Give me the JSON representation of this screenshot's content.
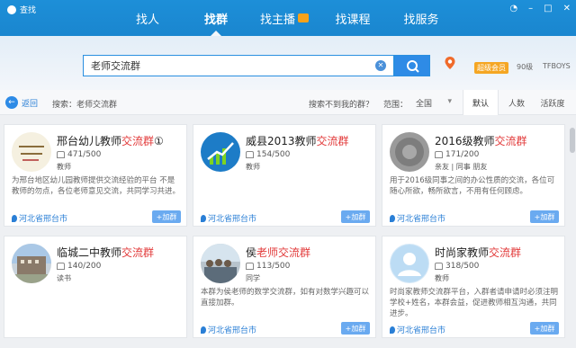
{
  "app": {
    "title": "查找"
  },
  "tabs": [
    {
      "label": "找人"
    },
    {
      "label": "找群",
      "active": true
    },
    {
      "label": "找主播"
    },
    {
      "label": "找课程"
    },
    {
      "label": "找服务"
    }
  ],
  "search": {
    "value": "老师交流群",
    "clear_icon": "close-icon",
    "button_icon": "search-icon"
  },
  "user": {
    "badge": "超级会员",
    "points": "90级",
    "name": "TFBOYS"
  },
  "filter": {
    "back_label": "返回",
    "search_label": "搜索：老师交流群",
    "no_result": "搜索不到我的群？",
    "range_label": "范围：",
    "range_value": "全国",
    "sort_tabs": [
      "默认",
      "人数",
      "活跃度"
    ]
  },
  "cards": [
    {
      "name_pre": "邢台幼儿教师",
      "name_hl": "交流群",
      "name_post": "①",
      "members": "471/500",
      "tags": "教师",
      "desc": "为邢台地区幼儿园教师提供交流经验的平台 不是教师的勿点，各位老师意见交流，共同学习共进。",
      "location": "河北省邢台市",
      "join": "+加群",
      "avatar": "text-logo"
    },
    {
      "name_pre": "威县2013教师",
      "name_hl": "交流群",
      "name_post": "",
      "members": "154/500",
      "tags": "教师",
      "desc": "",
      "location": "河北省邢台市",
      "join": "+加群",
      "avatar": "chart-logo"
    },
    {
      "name_pre": "2016级教师",
      "name_hl": "交流群",
      "name_post": "",
      "members": "171/200",
      "tags": "亲友 | 同事 朋友",
      "desc": "用于2016级同事之间的办公性质的交流，各位可随心所欲，畅所欲言，不用有任何顾虑。",
      "location": "河北省邢台市",
      "join": "+加群",
      "avatar": "gray-logo"
    },
    {
      "name_pre": "临城二中教师",
      "name_hl": "交流群",
      "name_post": "",
      "members": "140/200",
      "tags": "读书",
      "desc": "",
      "location": "",
      "join": "",
      "avatar": "building-logo"
    },
    {
      "name_pre": "侯",
      "name_hl": "老师交流群",
      "name_post": "",
      "members": "113/500",
      "tags": "同学",
      "desc": "本群为侯老师的数学交流群，如有对数学兴趣可以直接加群。",
      "location": "河北省邢台市",
      "join": "+加群",
      "avatar": "class-photo"
    },
    {
      "name_pre": "时尚家教师",
      "name_hl": "交流群",
      "name_post": "",
      "members": "318/500",
      "tags": "教师",
      "desc": "时尚家教师交流群平台，入群者请申请时必须注明学校+姓名，本群会益，促进教师相互沟通，共同进步。",
      "location": "河北省邢台市",
      "join": "+加群",
      "avatar": "default-avatar"
    }
  ],
  "colors": {
    "header": "#1d8fd8",
    "accent": "#2e8be6",
    "highlight": "#e23a3a",
    "join": "#6aaaf0"
  }
}
